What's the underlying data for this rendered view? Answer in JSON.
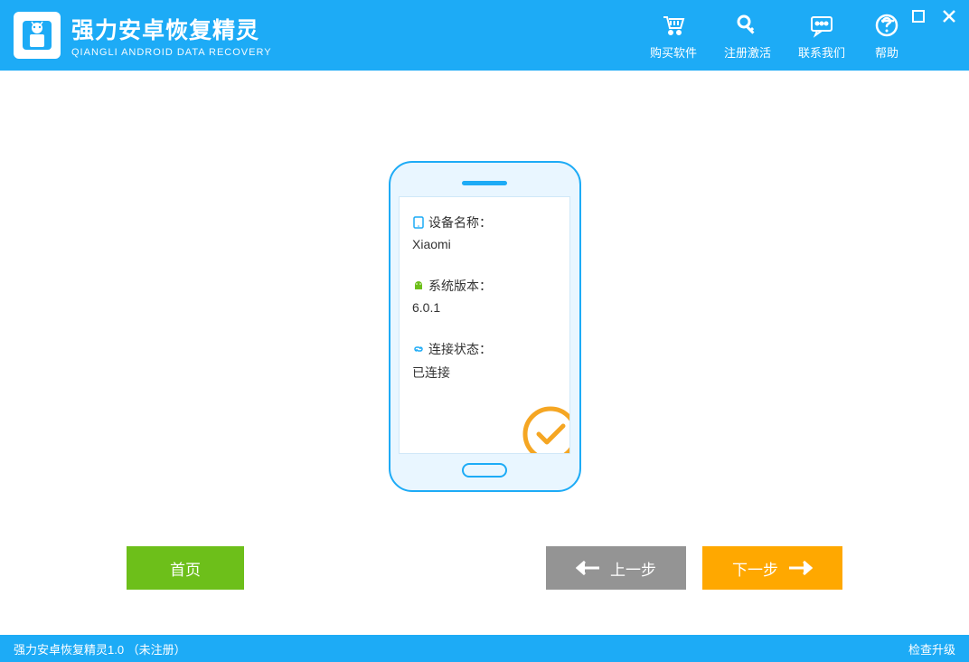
{
  "header": {
    "title": "强力安卓恢复精灵",
    "subtitle": "QIANGLI ANDROID DATA RECOVERY",
    "menu": {
      "buy": "购买软件",
      "register": "注册激活",
      "contact": "联系我们",
      "help": "帮助"
    }
  },
  "device": {
    "name_label": "设备名称：",
    "name_value": "Xiaomi",
    "system_label": "系统版本：",
    "system_value": "6.0.1",
    "connection_label": "连接状态：",
    "connection_value": "已连接"
  },
  "buttons": {
    "home": "首页",
    "prev": "上一步",
    "next": "下一步"
  },
  "footer": {
    "status": "强力安卓恢复精灵1.0 （未注册）",
    "update": "检查升级"
  },
  "colors": {
    "primary": "#1dabf6",
    "green": "#6dbf1a",
    "orange": "#ffa800",
    "gray": "#949494",
    "check": "#f5a623"
  }
}
